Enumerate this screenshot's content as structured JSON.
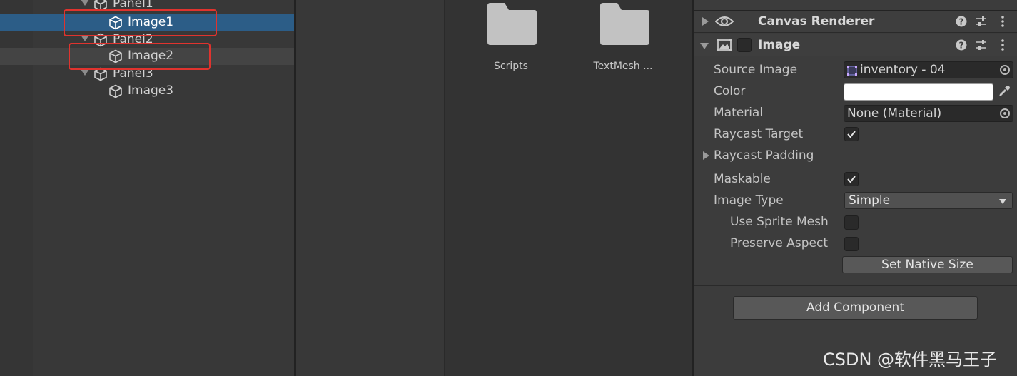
{
  "hierarchy": {
    "items": [
      {
        "label": "Panel1",
        "selected": false
      },
      {
        "label": "Image1",
        "selected": true
      },
      {
        "label": "Panel2",
        "selected": false
      },
      {
        "label": "Image2",
        "selected": false
      },
      {
        "label": "Panel3",
        "selected": false
      },
      {
        "label": "Image3",
        "selected": false
      }
    ],
    "highlight_color": "#e0332e",
    "selection_color": "#2c5d87"
  },
  "project": {
    "folders": [
      {
        "label": "Scripts"
      },
      {
        "label": "TextMesh ..."
      }
    ]
  },
  "inspector": {
    "canvas_renderer": {
      "title": "Canvas Renderer"
    },
    "image": {
      "title": "Image",
      "source_image_label": "Source Image",
      "source_image_value": "inventory - 04",
      "color_label": "Color",
      "color_value": "#ffffff",
      "material_label": "Material",
      "material_value": "None (Material)",
      "raycast_target_label": "Raycast Target",
      "raycast_target_checked": true,
      "raycast_padding_label": "Raycast Padding",
      "maskable_label": "Maskable",
      "maskable_checked": true,
      "image_type_label": "Image Type",
      "image_type_value": "Simple",
      "use_sprite_mesh_label": "Use Sprite Mesh",
      "use_sprite_mesh_checked": false,
      "preserve_aspect_label": "Preserve Aspect",
      "preserve_aspect_checked": false,
      "set_native_size_label": "Set Native Size"
    },
    "add_component_label": "Add Component"
  },
  "watermark": "CSDN @软件黑马王子"
}
